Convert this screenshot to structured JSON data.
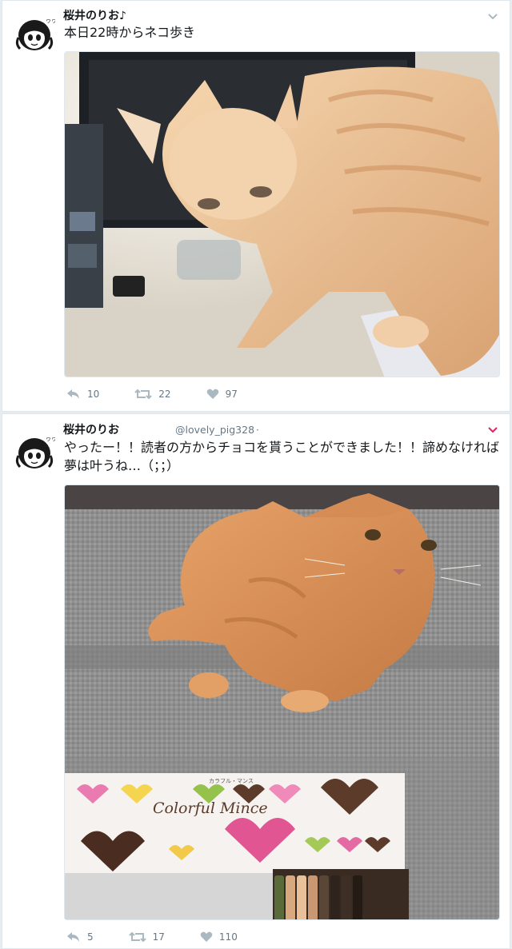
{
  "tweets": [
    {
      "author": "桜井のりお",
      "author_suffix": "♪",
      "text": "本日22時からネコ歩き",
      "image": "orange-tabby-cat-on-desk-photo",
      "replies": "10",
      "retweets": "22",
      "likes": "97"
    },
    {
      "author": "桜井のりお",
      "handle": "@lovely_pig328",
      "dot": "·",
      "text": "やったー！！読者の方からチョコを貰うことができました！！諦めなければ夢は叶うね…（；；）",
      "image": "orange-cat-on-sofa-with-chocolate-box-photo",
      "box_brand_small": "カラフル・マンス",
      "box_brand": "Colorful Mince",
      "replies": "5",
      "retweets": "17",
      "likes": "110"
    }
  ],
  "colors": {
    "text": "#14171a",
    "muted": "#657786",
    "border": "#e1e8ed",
    "background": "#e6ecf0",
    "caret_active": "#e0245e"
  }
}
